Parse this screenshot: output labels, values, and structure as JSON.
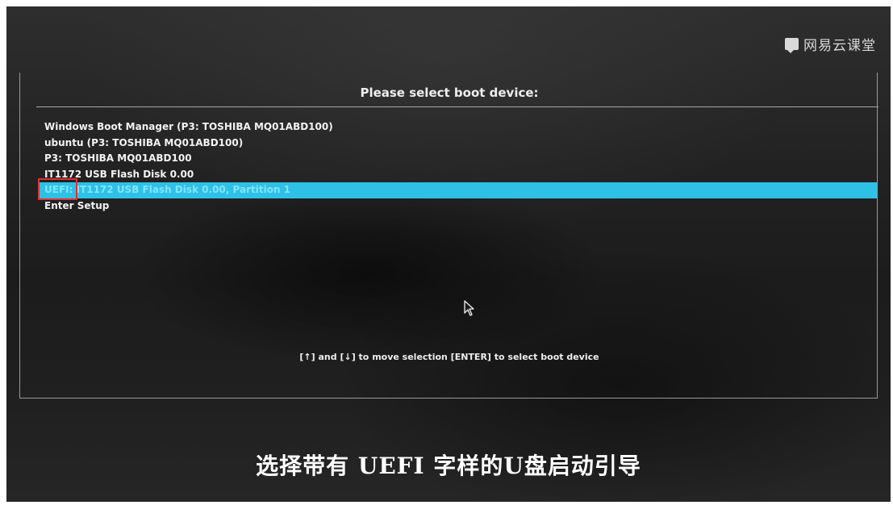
{
  "watermark": {
    "icon": "video-course-icon",
    "text": "网易云课堂"
  },
  "boot_menu": {
    "title": "Please select boot device:",
    "items": [
      {
        "label": "Windows Boot Manager (P3: TOSHIBA MQ01ABD100)"
      },
      {
        "label": "ubuntu (P3: TOSHIBA MQ01ABD100)"
      },
      {
        "label": "P3: TOSHIBA MQ01ABD100"
      },
      {
        "label": "IT1172 USB Flash Disk 0.00"
      },
      {
        "label": "UEFI: IT1172 USB Flash Disk 0.00, Partition 1",
        "selected": true
      },
      {
        "label": "Enter Setup"
      }
    ],
    "hint": "[↑] and [↓] to move selection    [ENTER] to select boot device"
  },
  "caption": "选择带有 UEFI 字样的U盘启动引导",
  "colors": {
    "selection": "#2fc0e6",
    "highlight_box": "#e03030",
    "text": "#f2f2f2"
  }
}
